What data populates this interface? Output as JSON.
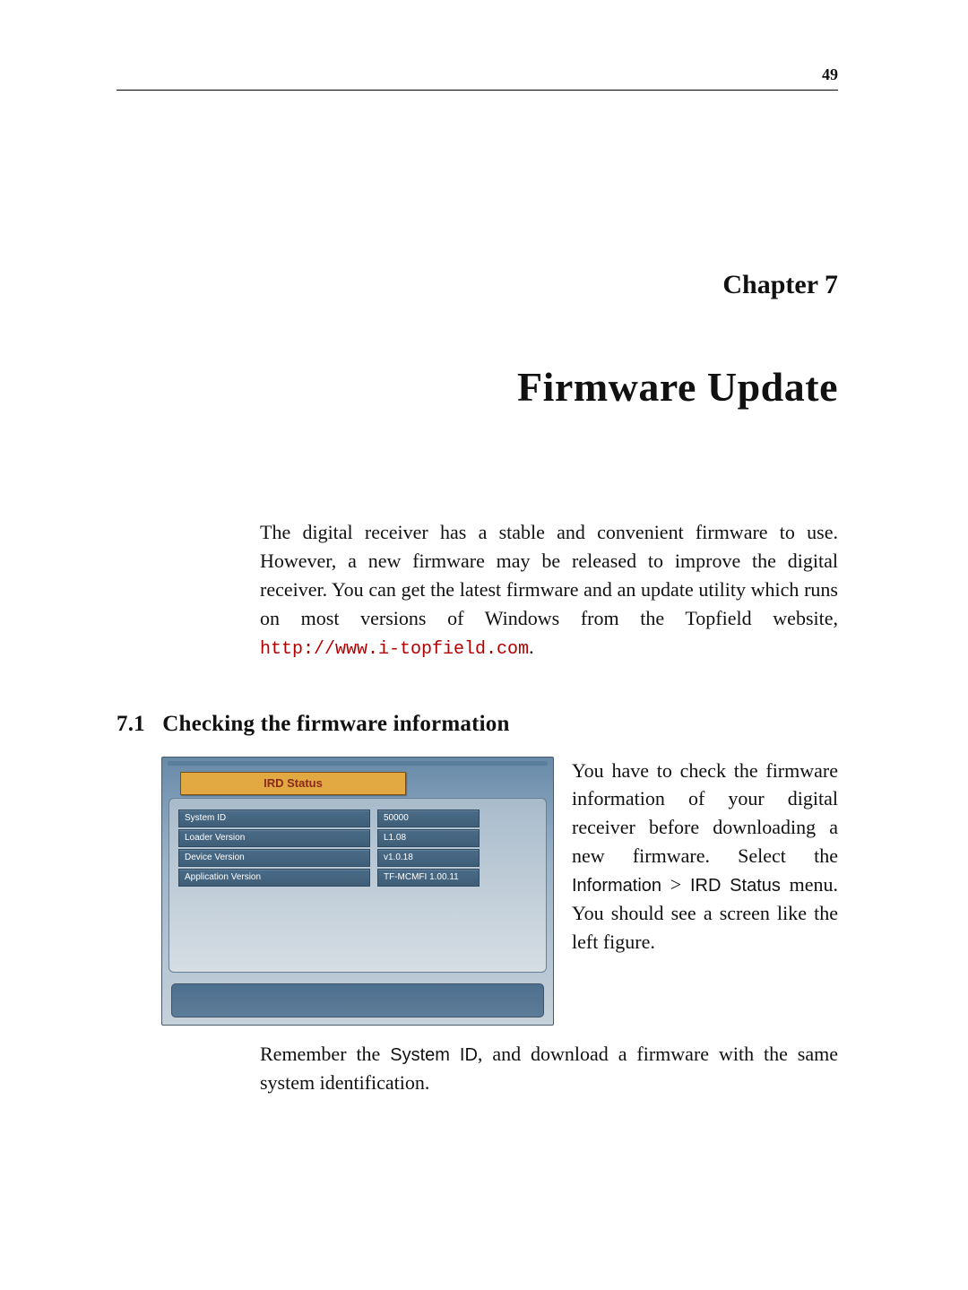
{
  "pageNumber": "49",
  "chapterLabel": "Chapter 7",
  "chapterTitle": "Firmware Update",
  "intro": {
    "p1a": "The digital receiver has a stable and convenient firmware to use. However, a new firmware may be released to improve the digital receiver. You can get the latest firmware and an update utility which runs on most versions of Windows from the Topfield website, ",
    "url": "http://www.i-topfield.com",
    "p1b": "."
  },
  "section": {
    "number": "7.1",
    "title": "Checking the firmware information"
  },
  "ird": {
    "title": "IRD Status",
    "rows": [
      {
        "label": "System ID",
        "value": "50000"
      },
      {
        "label": "Loader Version",
        "value": "L1.08"
      },
      {
        "label": "Device Version",
        "value": "v1.0.18"
      },
      {
        "label": "Application Version",
        "value": "TF-MCMFI 1.00.11"
      }
    ]
  },
  "side": {
    "a": "You have to check the firmware information of your digital receiver before downloading a new firmware. Select the ",
    "m1": "Information",
    "gt": " > ",
    "m2": "IRD Status",
    "b": " menu. You should see a screen like the left figure."
  },
  "after": {
    "a": "Remember the ",
    "m": "System ID",
    "b": ", and download a firmware with the same system identification."
  }
}
